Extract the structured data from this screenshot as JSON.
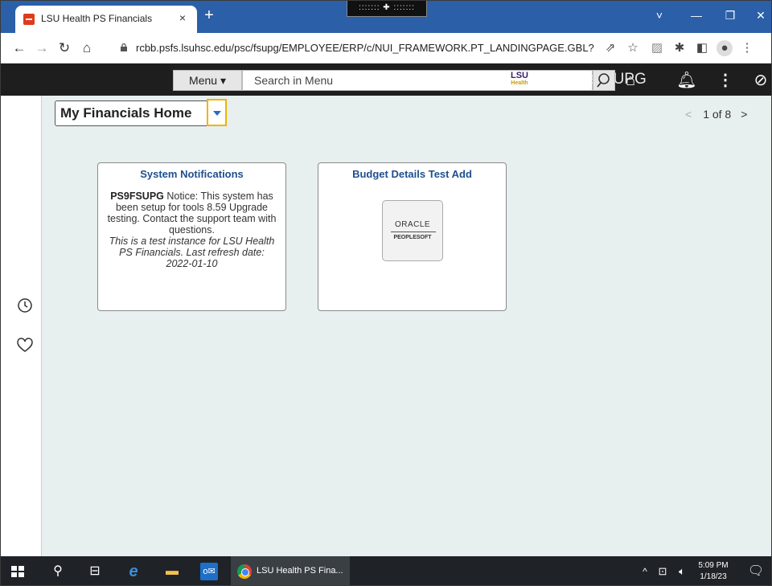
{
  "browser": {
    "tab_title": "LSU Health PS Financials",
    "tab_close": "×",
    "new_tab": "+",
    "drag_handle": "::::::: ✚ :::::::",
    "url": "rcbb.psfs.lsuhsc.edu/psc/fsupg/EMPLOYEE/ERP/c/NUI_FRAMEWORK.PT_LANDINGPAGE.GBL?",
    "window_controls": [
      "˅",
      "—",
      "❐",
      "✕"
    ]
  },
  "banner": {
    "menu_label": "Menu ▾",
    "search_placeholder": "Search in Menu",
    "logo_line1": "LSU",
    "logo_line2": "Health",
    "title_text": "als UPG"
  },
  "header": {
    "homepage_label": "My Financials Home",
    "pager_prev": "<",
    "pager_text": "1 of 8",
    "pager_next": ">"
  },
  "tiles": [
    {
      "title": "System Notifications",
      "bold_lead": "PS9FSUPG",
      "body_text": " Notice: This system has been setup for tools 8.59 Upgrade testing. Contact the support team with questions.",
      "italic_text": "This is a test instance for LSU Health PS Financials. Last refresh date: 2022-01-10"
    },
    {
      "title": "Budget Details Test Add",
      "logo_line1": "ORACLE",
      "logo_line2": "PEOPLESOFT"
    }
  ],
  "taskbar": {
    "chrome_label": "LSU Health PS Fina...",
    "time": "5:09 PM",
    "date": "1/18/23"
  },
  "colors": {
    "tab_strip": "#2b5fa8",
    "banner": "#1e1e1e",
    "content_bg": "#e8efef",
    "tile_title": "#1f4f8f",
    "focus_outline": "#f0b400"
  }
}
